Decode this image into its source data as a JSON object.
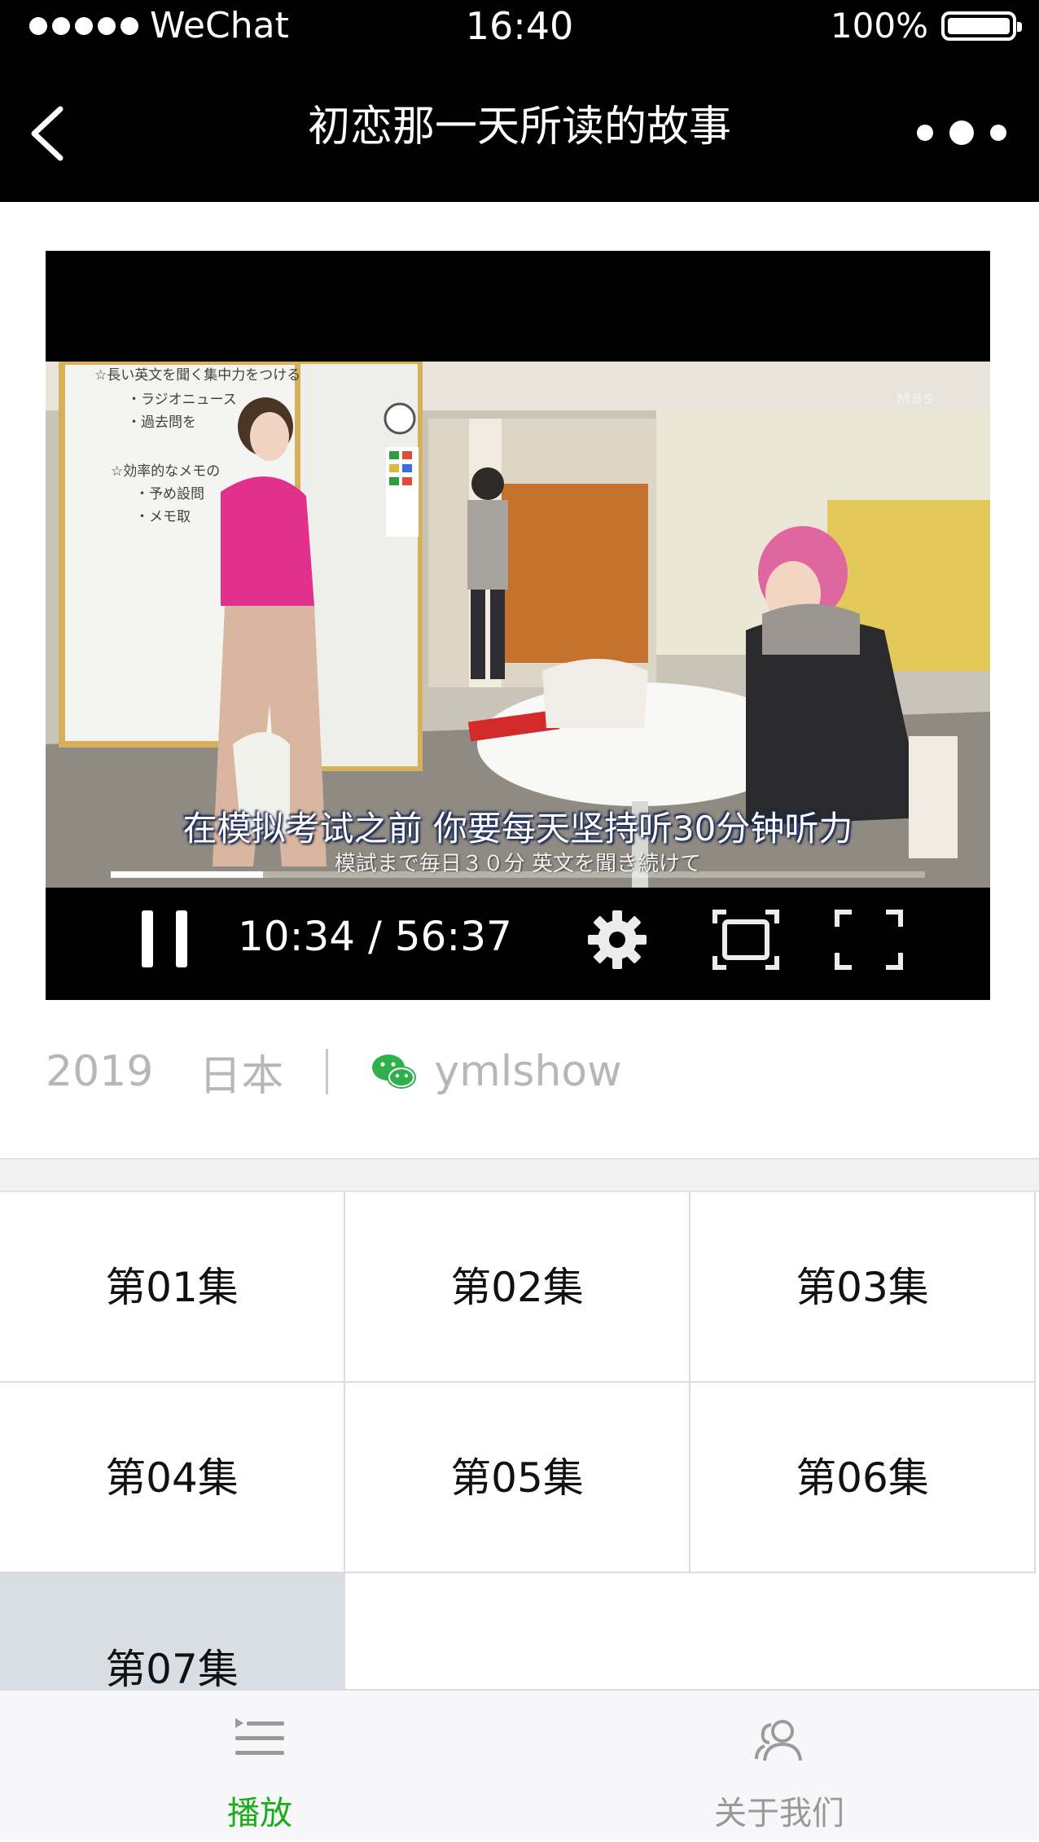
{
  "status_bar": {
    "carrier": "WeChat",
    "time": "16:40",
    "battery": "100%",
    "signal_icon": "signal-dots-icon",
    "battery_icon": "battery-icon"
  },
  "nav": {
    "title": "初恋那一天所读的故事",
    "back_icon": "chevron-left-icon",
    "more_icon": "more-dots-icon"
  },
  "player": {
    "subtitle_main": "在模拟考试之前 你要每天坚持听30分钟听力",
    "subtitle_sub": "模試まで毎日３０分 英文を聞き続けて",
    "time_display": "10:34 / 56:37",
    "progress_fraction": 0.187,
    "channel_watermark": "MBS",
    "whiteboard_text": [
      "☆長い英文を聞く集中力をつける",
      "・ラジオニュース",
      "・過去問を",
      "☆効率的なメモの",
      "・予め設問",
      "・メモ取"
    ]
  },
  "meta": {
    "year": "2019",
    "country": "日本",
    "account": "ymlshow",
    "account_icon": "wechat-icon"
  },
  "episodes": [
    {
      "label": "第01集"
    },
    {
      "label": "第02集"
    },
    {
      "label": "第03集"
    },
    {
      "label": "第04集"
    },
    {
      "label": "第05集"
    },
    {
      "label": "第06集"
    },
    {
      "label": "第07集",
      "active": true
    }
  ],
  "tabs": [
    {
      "label": "播放",
      "icon": "playlist-icon",
      "active": true,
      "color": "#1aad19"
    },
    {
      "label": "关于我们",
      "icon": "users-icon",
      "active": false,
      "color": "#999999"
    }
  ]
}
